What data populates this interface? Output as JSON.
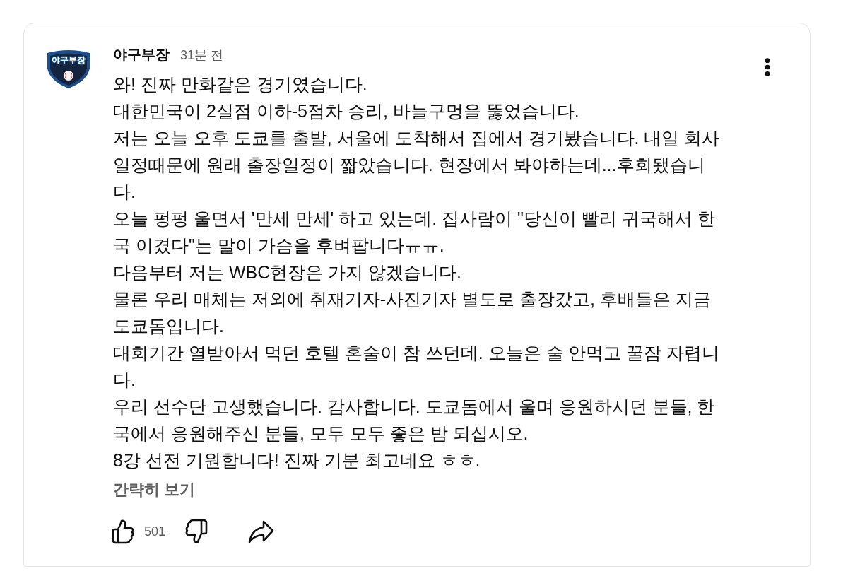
{
  "author": {
    "name": "야구부장",
    "time": "31분 전",
    "avatar_text": "야구부장"
  },
  "comment": {
    "lines": [
      "와! 진짜 만화같은 경기였습니다.",
      "대한민국이 2실점 이하-5점차 승리, 바늘구멍을 뚫었습니다.",
      "저는 오늘 오후 도쿄를 출발, 서울에 도착해서 집에서 경기봤습니다. 내일 회사 일정때문에 원래 출장일정이 짧았습니다. 현장에서 봐야하는데...후회됐습니다.",
      "오늘 펑펑 울면서 '만세 만세' 하고 있는데. 집사람이 \"당신이 빨리 귀국해서 한국 이겼다\"는 말이 가슴을 후벼팝니다ㅠㅠ.",
      "다음부터 저는 WBC현장은 가지 않겠습니다.",
      "물론 우리 매체는 저외에 취재기자-사진기자 별도로 출장갔고, 후배들은 지금 도쿄돔입니다.",
      "대회기간 열받아서 먹던 호텔 혼술이 참 쓰던데. 오늘은 술 안먹고 꿀잠 자렵니다.",
      "우리 선수단 고생했습니다. 감사합니다. 도쿄돔에서 울며 응원하시던 분들, 한국에서 응원해주신 분들, 모두 모두 좋은 밤 되십시오.",
      "8강 선전 기원합니다! 진짜 기분 최고네요 ㅎㅎ."
    ],
    "toggle": "간략히 보기"
  },
  "actions": {
    "like_count": "501"
  }
}
